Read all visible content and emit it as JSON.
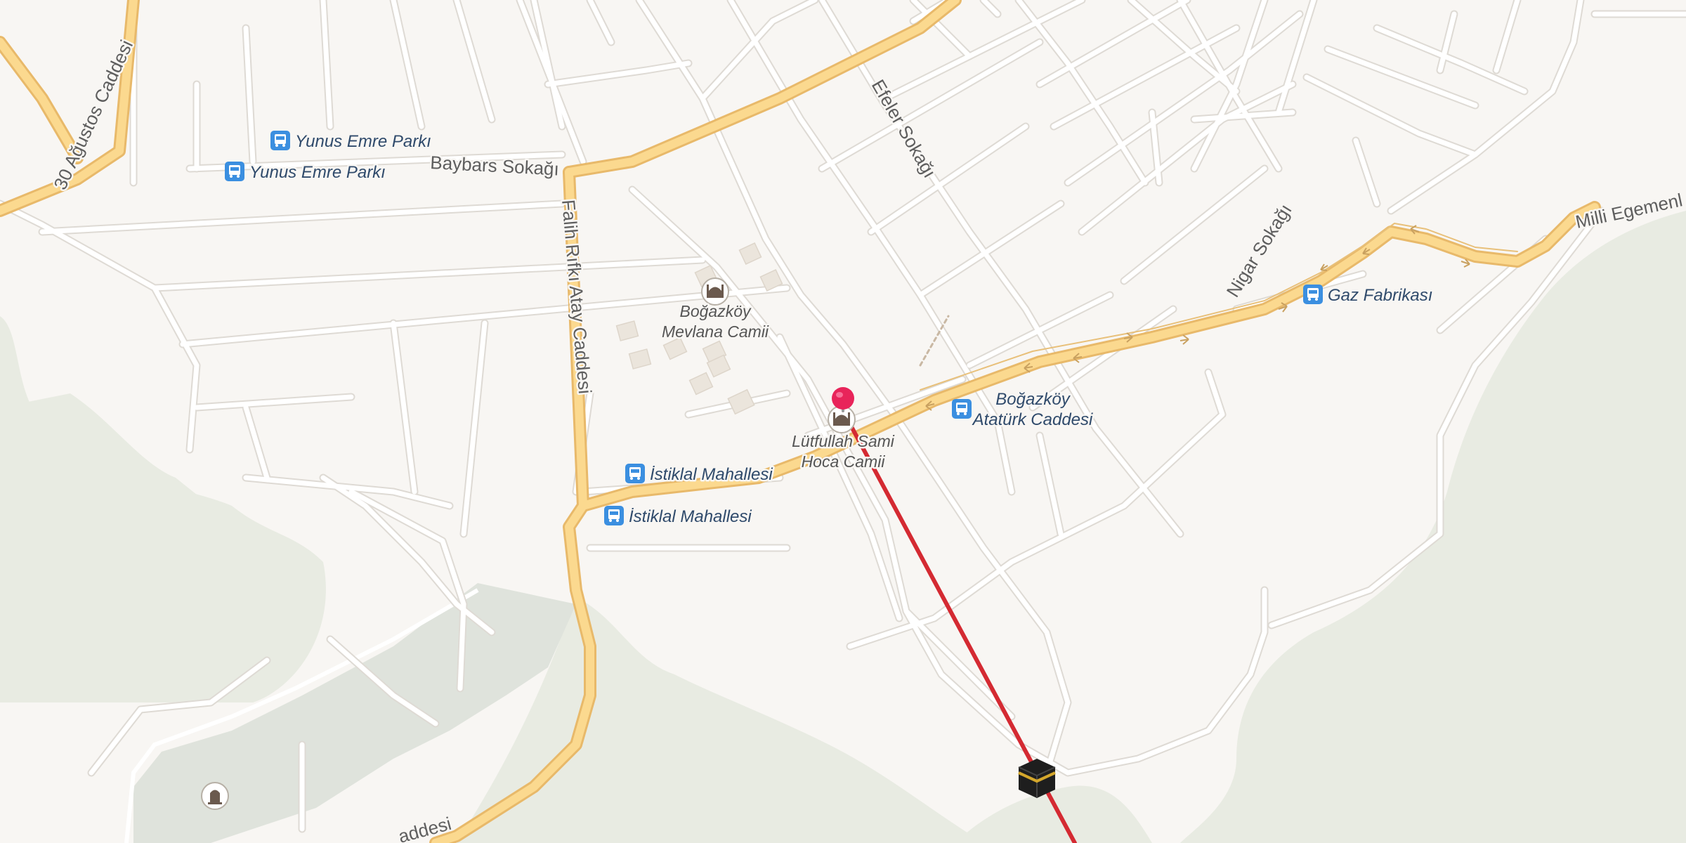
{
  "streets": {
    "otuz_agustos": "30 Ağustos Caddesi",
    "baybars": "Baybars Sokağı",
    "falih_rifki": "Falih Rıfkı Atay Caddesi",
    "efeler": "Efeler Sokağı",
    "nigar": "Nigar Sokağı",
    "milli_egemenlik": "Milli Egemenl",
    "bottom_caddesi": "addesi"
  },
  "bus_stops": [
    {
      "name": "Yunus Emre Parkı"
    },
    {
      "name": "Yunus Emre Parkı"
    },
    {
      "name": "İstiklal Mahallesi"
    },
    {
      "name": "İstiklal Mahallesi"
    },
    {
      "name_line1": "Boğazköy",
      "name_line2": "Atatürk Caddesi"
    },
    {
      "name": "Gaz Fabrikası"
    }
  ],
  "mosques": [
    {
      "name_line1": "Boğazköy",
      "name_line2": "Mevlana Camii"
    },
    {
      "name_line1": "Lütfullah Sami",
      "name_line2": "Hoca Camii"
    }
  ],
  "icons": {
    "bus_stop": "bus-stop-icon",
    "mosque": "mosque-icon",
    "kaaba": "kaaba-icon",
    "pin": "location-pin-icon",
    "cemetery": "cemetery-icon"
  },
  "colors": {
    "background": "#f8f6f3",
    "forest": "#e7eae0",
    "cemetery": "#dfe2dc",
    "road_minor": "#ffffff",
    "road_casing": "#dedad4",
    "road_major": "#fbd98f",
    "road_major_casing": "#e8b96a",
    "qibla_line": "#d42a32",
    "pin": "#e8245a",
    "poi_text": "#2f4a6b",
    "bus_stop": "#3b8fe0"
  }
}
